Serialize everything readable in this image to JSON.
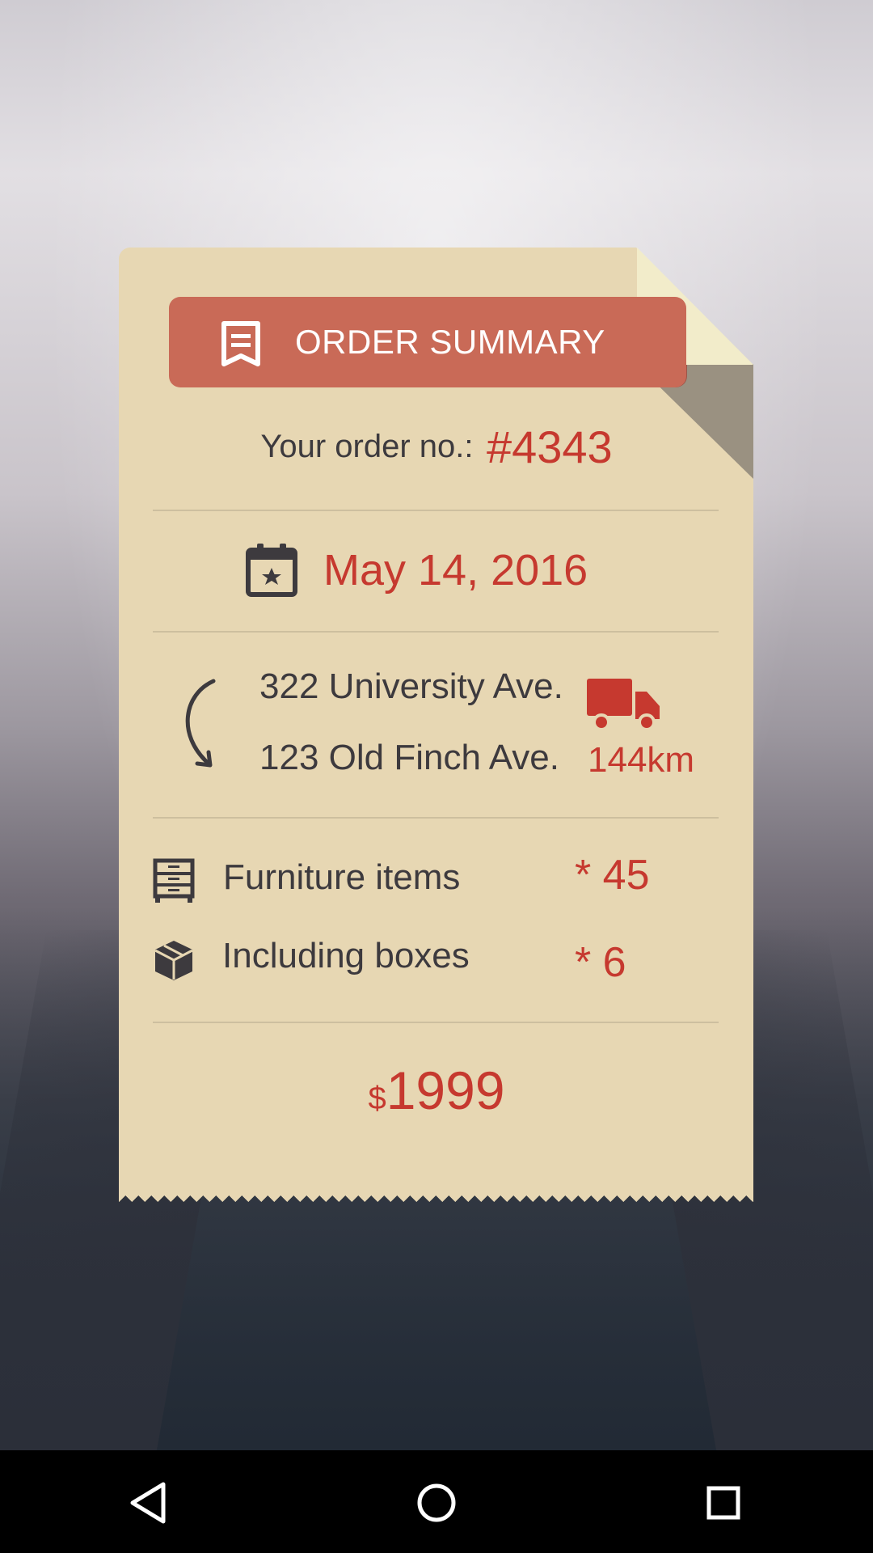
{
  "order_summary": {
    "banner_title": "ORDER SUMMARY",
    "order_label": "Your order no.:",
    "order_number": "#4343",
    "date": "May 14, 2016",
    "from_address": "322 University Ave.",
    "to_address": "123 Old Finch Ave.",
    "distance": "144km",
    "furniture_label": "Furniture items",
    "furniture_count": "* 45",
    "boxes_label": "Including boxes",
    "boxes_count": "* 6",
    "total_currency": "$",
    "total_value": "1999"
  },
  "icons": {
    "banner": "receipt-icon",
    "date": "calendar-icon",
    "route": "curved-arrow-icon",
    "vehicle": "truck-icon",
    "furniture": "dresser-icon",
    "boxes": "box-icon",
    "nav_back": "back-triangle-icon",
    "nav_home": "home-circle-icon",
    "nav_recent": "recents-square-icon"
  },
  "colors": {
    "accent_red": "#c6392f",
    "banner": "#c96a57",
    "paper": "#e7d7b3",
    "text_dark": "#3d3a3e"
  }
}
